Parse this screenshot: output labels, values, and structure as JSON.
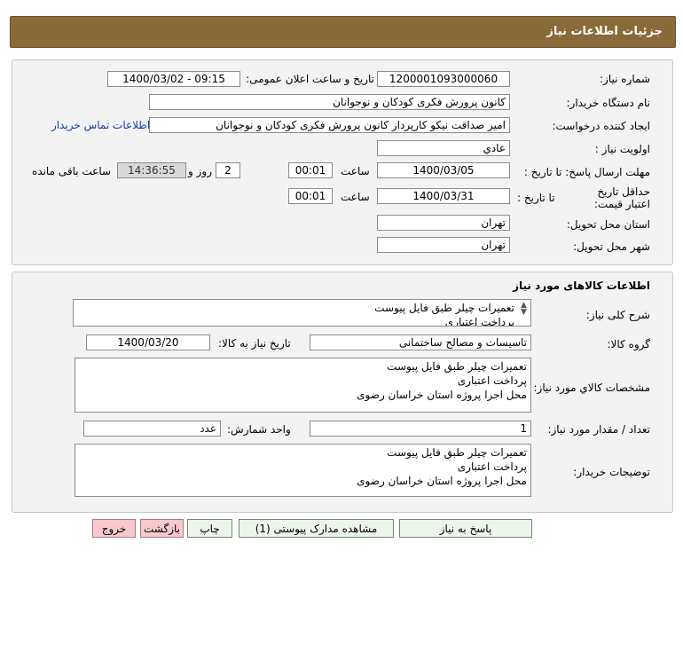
{
  "header": {
    "title": "جزئیات اطلاعات نیاز"
  },
  "need": {
    "need_number_label": "شماره نیاز:",
    "need_number": "1200001093000060",
    "announce_label": "تاریخ و ساعت اعلان عمومی:",
    "announce_value": "1400/03/02 - 09:15",
    "buyer_org_label": "نام دستگاه خریدار:",
    "buyer_org": "کانون پرورش فکری کودکان و نوجوانان",
    "requester_label": "ایجاد کننده درخواست:",
    "requester": "امیر صداقت نیکو کارپرداز کانون پرورش فکری کودکان و نوجوانان",
    "contact_link": "اطلاعات تماس خریدار",
    "priority_label": "اولویت نیاز :",
    "priority": "عادي",
    "deadline_label": "مهلت ارسال پاسخ: تا تاریخ :",
    "deadline_date": "1400/03/05",
    "time_label": "ساعت",
    "deadline_time": "00:01",
    "days_value": "2",
    "days_label": "روز و",
    "remaining_time": "14:36:55",
    "remaining_label": "ساعت باقی مانده",
    "validity_label": "حداقل تاریخ اعتبار قیمت:",
    "validity_to_label": "تا تاریخ :",
    "validity_date": "1400/03/31",
    "validity_time_label": "ساعت",
    "validity_time": "00:01",
    "province_label": "استان محل تحویل:",
    "province": "تهران",
    "city_label": "شهر محل تحویل:",
    "city": "تهران"
  },
  "goods": {
    "section_title": "اطلاعات کالاهای مورد نیاز",
    "summary_label": "شرح کلی نیاز:",
    "summary": "تعمیرات چیلر طبق فایل پیوست\nپرداخت اعتباری",
    "group_label": "گروه کالا:",
    "group": "تاسیسات و مصالح ساختمانی",
    "need_date_label": "تاریخ نیاز به کالا:",
    "need_date": "1400/03/20",
    "spec_label": "مشخصات کالاي مورد نياز:",
    "spec": "تعمیرات چیلر طبق فایل پیوست\nپرداخت اعتباری\nمحل اجرا پروژه استان خراسان رضوی",
    "qty_label": "تعداد / مقدار مورد نیاز:",
    "qty": "1",
    "unit_label": "واحد شمارش:",
    "unit": "عدد",
    "buyer_notes_label": "توضیحات خریدار:",
    "buyer_notes": "تعمیرات چیلر طبق فایل پیوست\nپرداخت اعتباری\nمحل اجرا پروژه استان خراسان رضوی"
  },
  "buttons": {
    "reply": "پاسخ به نیاز",
    "attachments": "مشاهده مدارک پیوستی (1)",
    "print": "چاپ",
    "back": "بازگشت",
    "exit": "خروج"
  }
}
